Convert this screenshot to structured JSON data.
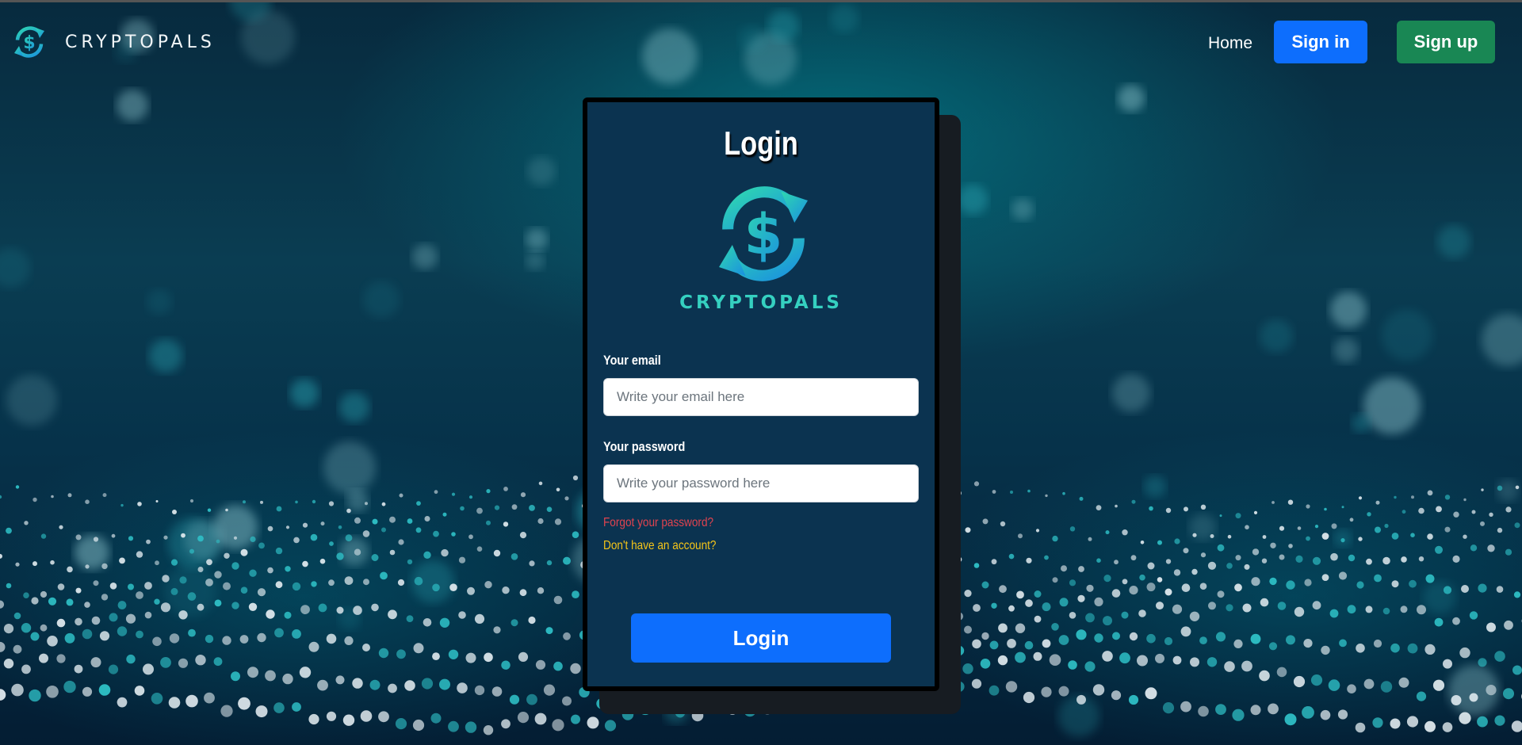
{
  "brand": {
    "name": "CRYPTOPALS",
    "logo_icon": "dollar-cycle-arrows-icon",
    "accent_start": "#2fd8b0",
    "accent_end": "#1a8fe0"
  },
  "nav": {
    "home_label": "Home",
    "signin_label": "Sign in",
    "signup_label": "Sign up",
    "signin_color": "#0d6efd",
    "signup_color": "#198754"
  },
  "login": {
    "title": "Login",
    "wordmark": "CRYPTOPALS",
    "email_label": "Your email",
    "email_placeholder": "Write your email here",
    "password_label": "Your password",
    "password_placeholder": "Write your password here",
    "forgot_link": "Forgot your password?",
    "no_account_link": "Don't have an account?",
    "submit_label": "Login"
  }
}
